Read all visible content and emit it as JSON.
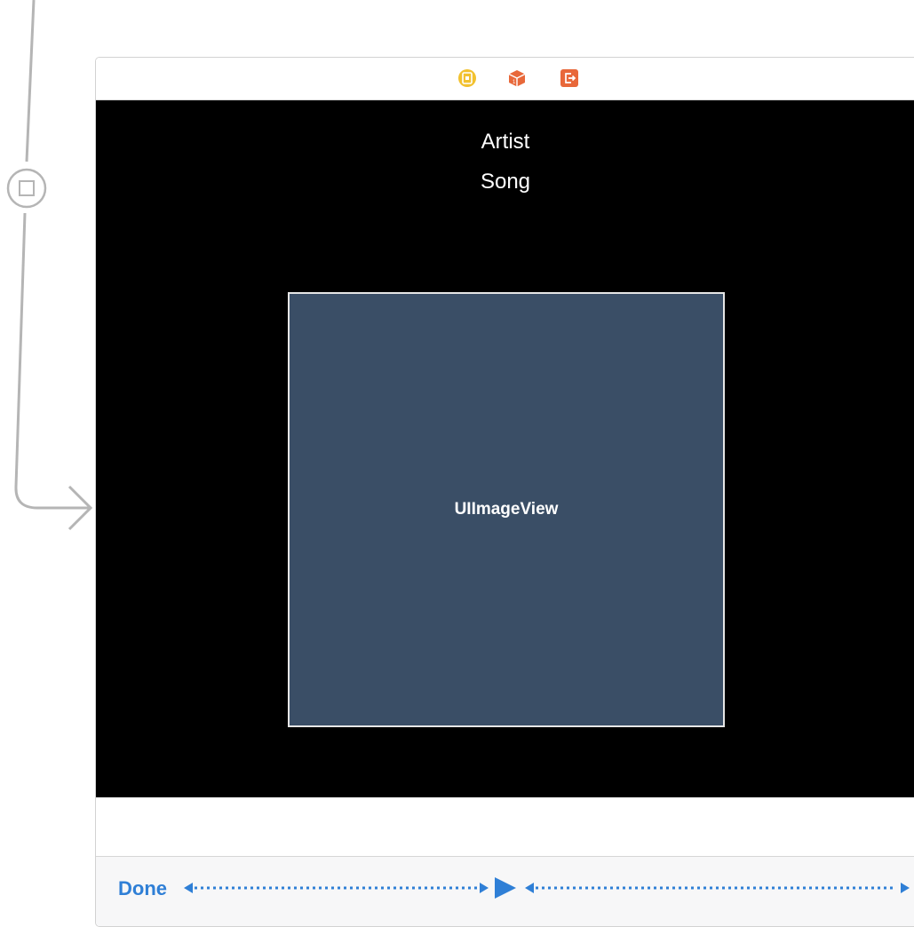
{
  "scene_dock": {
    "icons": [
      "view-controller-icon",
      "first-responder-icon",
      "exit-icon"
    ]
  },
  "labels": {
    "artist": "Artist",
    "song": "Song"
  },
  "image_view": {
    "label": "UIImageView"
  },
  "toolbar": {
    "done_label": "Done",
    "play_icon": "play-icon"
  },
  "colors": {
    "image_view_fill": "#3a4e66",
    "toolbar_tint": "#2f7fd6",
    "segue_line": "#b5b5b5",
    "dock_yellow": "#f2c12e",
    "dock_orange": "#e8683a"
  }
}
